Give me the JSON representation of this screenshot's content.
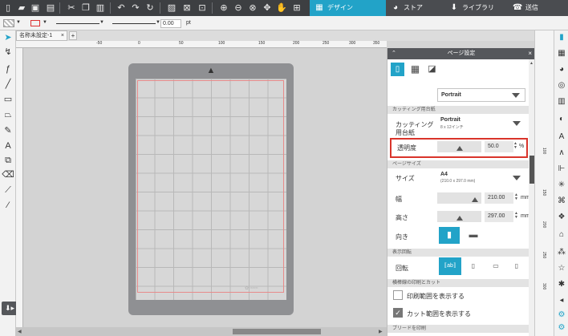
{
  "app": {
    "accent": "#22a3c8",
    "selection_highlight": "#d9342b"
  },
  "nav_tabs": [
    {
      "label": "デザイン",
      "icon": "design-icon",
      "active": true
    },
    {
      "label": "ストア",
      "icon": "store-icon",
      "active": false
    },
    {
      "label": "ライブラリ",
      "icon": "library-icon",
      "active": false
    },
    {
      "label": "送信",
      "icon": "send-icon",
      "active": false
    }
  ],
  "linebar": {
    "line_width_value": "0.00",
    "line_width_unit": "pt"
  },
  "document": {
    "tab_title": "名称未設定-1",
    "add_tab": "+"
  },
  "rulers": {
    "top_ticks": [
      "-50",
      "0",
      "50",
      "100",
      "150",
      "200",
      "250",
      "300",
      "350",
      "400",
      "450"
    ],
    "left_ticks": [
      "150",
      "200",
      "250"
    ],
    "right_ticks": [
      "100",
      "150",
      "200",
      "250",
      "300"
    ]
  },
  "panel": {
    "title": "ページ設定",
    "media_dropdown": "Portrait",
    "sections": {
      "cutting_mat": "カッティング用台紙",
      "page_size": "ページサイズ",
      "display_rotation": "表示回転",
      "print_and_cut": "横棒線の印刷とカット",
      "bleed": "ブリードを印刷"
    },
    "cutting_mat": {
      "label": "カッティング用台紙",
      "value": "Portrait",
      "sub": "8 x 12インチ"
    },
    "transparency": {
      "label": "透明度",
      "value": "50.0",
      "unit": "%",
      "fill_fraction": 0.5
    },
    "size": {
      "label": "サイズ",
      "value": "A4",
      "sub": "(210.0 x 297.0 mm)"
    },
    "width": {
      "label": "幅",
      "value": "210.00",
      "unit": "mm",
      "fill_fraction": 0.8
    },
    "height": {
      "label": "高さ",
      "value": "297.00",
      "unit": "mm",
      "fill_fraction": 0.5
    },
    "orientation": {
      "label": "向き"
    },
    "rotation": {
      "label": "回転"
    },
    "checkbox_print_area": {
      "label": "印刷範囲を表示する",
      "checked": false
    },
    "checkbox_cut_area": {
      "label": "カット範囲を表示する",
      "checked": true
    }
  }
}
